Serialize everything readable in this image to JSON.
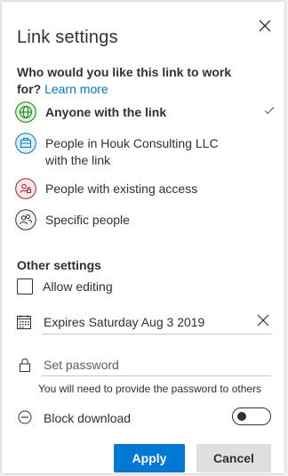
{
  "dialog": {
    "title": "Link settings",
    "close_icon": "close-icon"
  },
  "audience": {
    "question": "Who would you like this link to work for?",
    "learn_more": "Learn more",
    "options": [
      {
        "label": "Anyone with the link",
        "icon": "globe-icon",
        "selected": true
      },
      {
        "label": "People in Houk Consulting LLC with the link",
        "icon": "briefcase-icon",
        "selected": false
      },
      {
        "label": "People with existing access",
        "icon": "existing-access-icon",
        "selected": false
      },
      {
        "label": "Specific people",
        "icon": "people-icon",
        "selected": false
      }
    ]
  },
  "other_settings": {
    "title": "Other settings",
    "allow_editing": {
      "label": "Allow editing",
      "checked": false
    },
    "expires": {
      "label": "Expires Saturday Aug 3 2019"
    },
    "password": {
      "placeholder": "Set password",
      "hint": "You will need to provide the password to others"
    },
    "block_download": {
      "label": "Block download",
      "on": false
    }
  },
  "actions": {
    "apply": "Apply",
    "cancel": "Cancel"
  },
  "colors": {
    "accent": "#0078d4",
    "globe": "#107c10",
    "briefcase": "#0078d4",
    "existing_access": "#a4262c",
    "text": "#323130"
  }
}
